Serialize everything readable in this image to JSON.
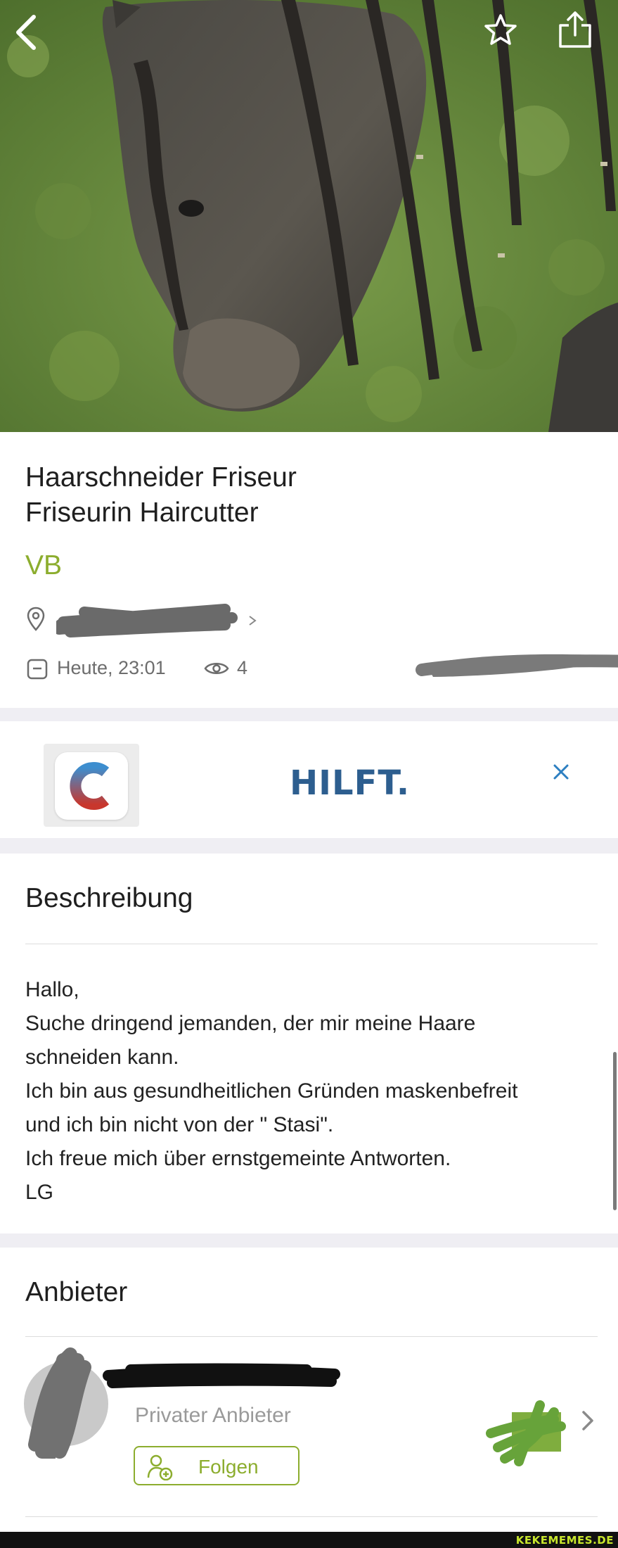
{
  "listing": {
    "title_line1": "Haarschneider Friseur",
    "title_line2": "Friseurin Haircutter",
    "price": "VB",
    "date": "Heute, 23:01",
    "views": "4"
  },
  "ad": {
    "text": "HILFT."
  },
  "description": {
    "heading": "Beschreibung",
    "lines": [
      "Hallo,",
      "Suche dringend jemanden, der mir meine Haare",
      "schneiden kann.",
      "Ich bin aus gesundheitlichen Gründen maskenbefreit",
      "und ich bin nicht von der \" Stasi\".",
      "Ich freue mich über ernstgemeinte Antworten.",
      "LG"
    ]
  },
  "seller": {
    "heading": "Anbieter",
    "type": "Privater Anbieter",
    "follow_label": "Folgen"
  },
  "watermark": "KEKEMEMES.DE",
  "icons": {
    "back": "chevron-left-icon",
    "favorite": "star-icon",
    "share": "share-icon",
    "location": "location-pin-icon",
    "calendar": "calendar-icon",
    "views": "eye-icon",
    "close": "close-icon",
    "follow": "person-add-icon",
    "open_seller": "chevron-right-icon"
  },
  "colors": {
    "accent": "#8cad2e",
    "ad_text": "#2d5e8f",
    "ad_close": "#2d7fc1",
    "meta_gray": "#6d6d6d",
    "separator": "#efeef3"
  }
}
